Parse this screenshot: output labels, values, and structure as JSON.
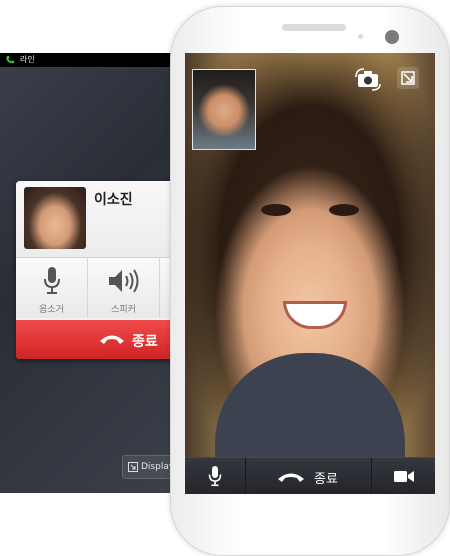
{
  "back_screen": {
    "status_bar": {
      "app_name": "라인",
      "phone_icon": "phone-icon"
    },
    "caller": {
      "name": "이소진",
      "avatar": "caller-avatar"
    },
    "actions": [
      {
        "label": "음소거",
        "icon": "microphone-icon"
      },
      {
        "label": "스피커",
        "icon": "speaker-icon"
      }
    ],
    "end_call": {
      "label": "종료",
      "icon": "hangup-icon"
    },
    "display_button": {
      "label": "Display",
      "icon": "display-icon"
    }
  },
  "front_screen": {
    "top_controls": {
      "camera_switch_icon": "camera-switch-icon",
      "minimize_icon": "minimize-icon"
    },
    "toolbar": {
      "mute_icon": "microphone-icon",
      "end_label": "종료",
      "end_icon": "hangup-icon",
      "video_icon": "video-camera-icon"
    }
  },
  "colors": {
    "end_call_red": "#e03333",
    "toolbar_dark": "#2a2c32",
    "phone_white": "#ffffff"
  }
}
